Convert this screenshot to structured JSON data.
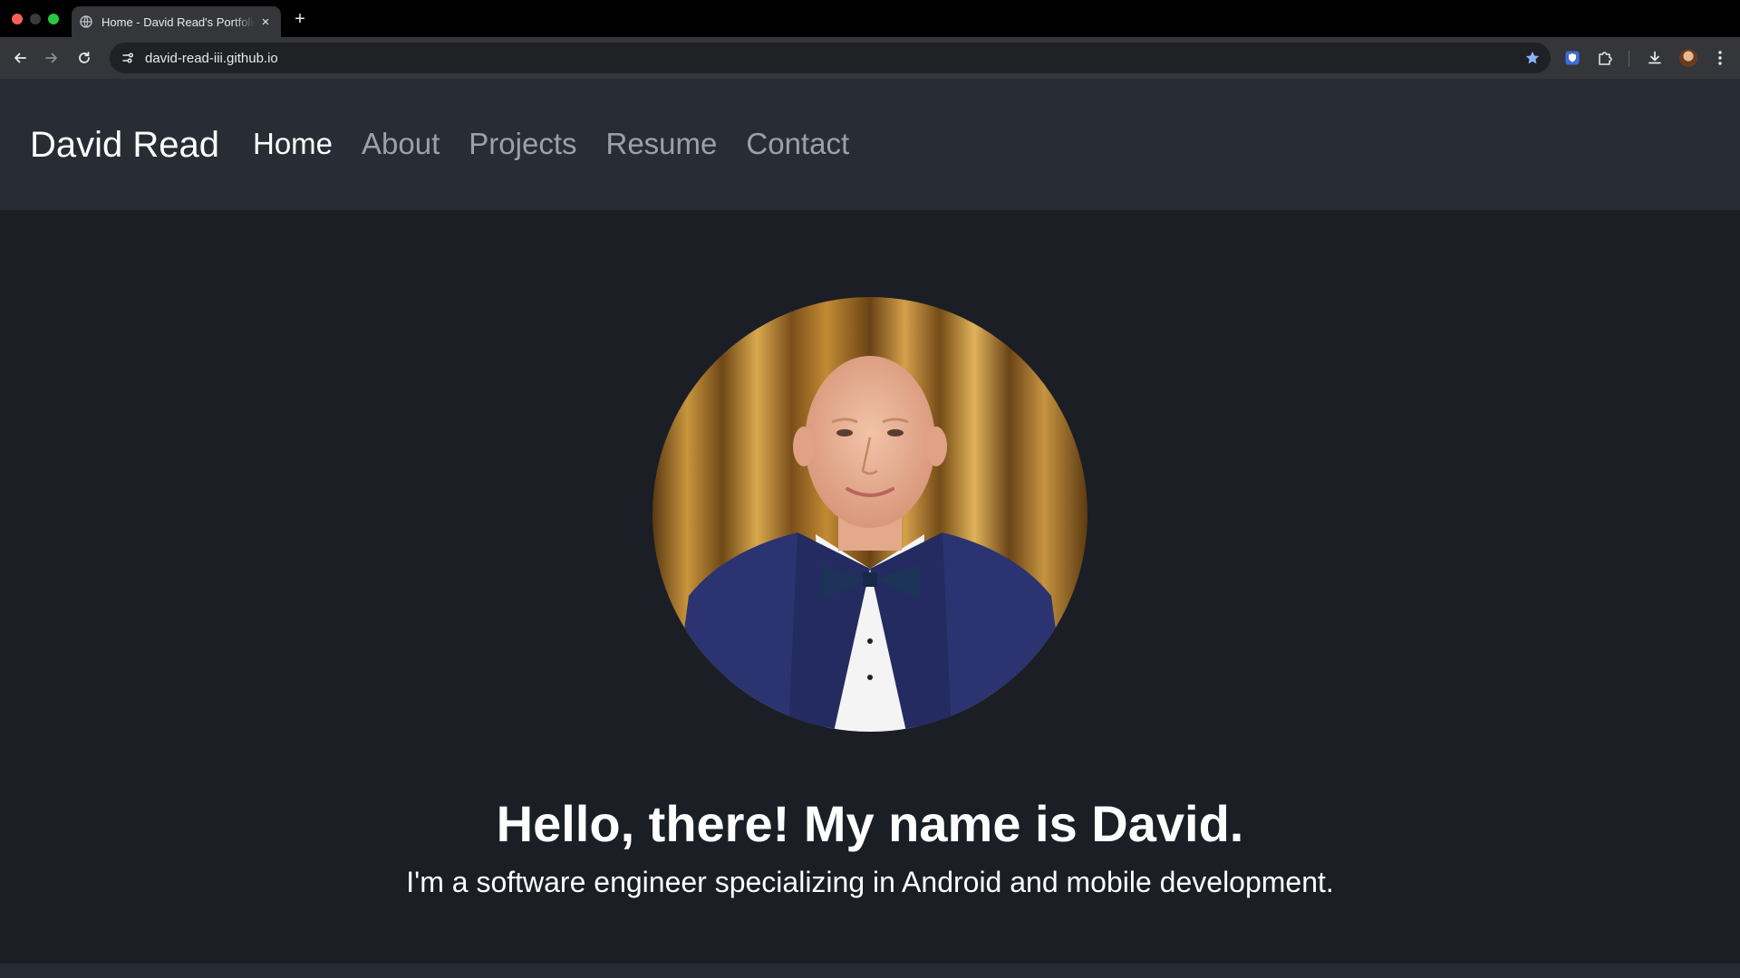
{
  "browser": {
    "tab": {
      "title": "Home - David Read's Portfolio",
      "favicon": "globe-icon",
      "close_label": "×"
    },
    "new_tab_label": "+",
    "address_bar": {
      "url": "david-read-iii.github.io",
      "site_info_icon": "site-settings-icon"
    },
    "toolbar_icons": [
      "back-arrow-icon",
      "forward-arrow-icon",
      "reload-icon",
      "bookmark-star-icon",
      "bitwarden-shield-icon",
      "extensions-puzzle-icon",
      "download-icon",
      "profile-avatar",
      "more-menu-icon"
    ],
    "colors": {
      "star": "#8ab4f8",
      "shield": "#3d6bd9"
    }
  },
  "site": {
    "brand": "David Read",
    "nav": [
      {
        "label": "Home",
        "active": true
      },
      {
        "label": "About",
        "active": false
      },
      {
        "label": "Projects",
        "active": false
      },
      {
        "label": "Resume",
        "active": false
      },
      {
        "label": "Contact",
        "active": false
      }
    ],
    "hero": {
      "headline": "Hello, there! My name is David.",
      "subline": "I'm a software engineer specializing in Android and mobile development."
    },
    "colors": {
      "background": "#1b1e25",
      "navbar": "#282c35",
      "nav_inactive": "#9da0a6",
      "nav_active": "#ffffff"
    }
  }
}
